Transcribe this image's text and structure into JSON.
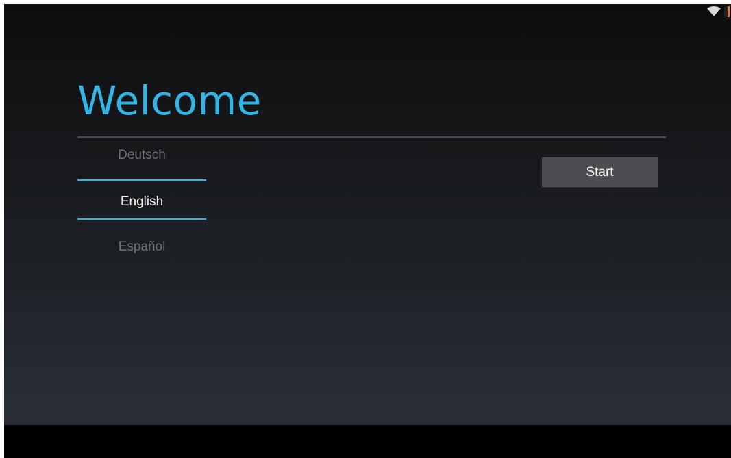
{
  "welcome": {
    "title": "Welcome"
  },
  "language_picker": {
    "options": [
      "Deutsch",
      "English",
      "Español"
    ],
    "selected": "English"
  },
  "start_button": {
    "label": "Start"
  },
  "status_bar": {
    "icons": [
      "wifi-icon",
      "battery-icon"
    ]
  },
  "colors": {
    "accent": "#33b5e5",
    "battery": "#e7772a"
  }
}
